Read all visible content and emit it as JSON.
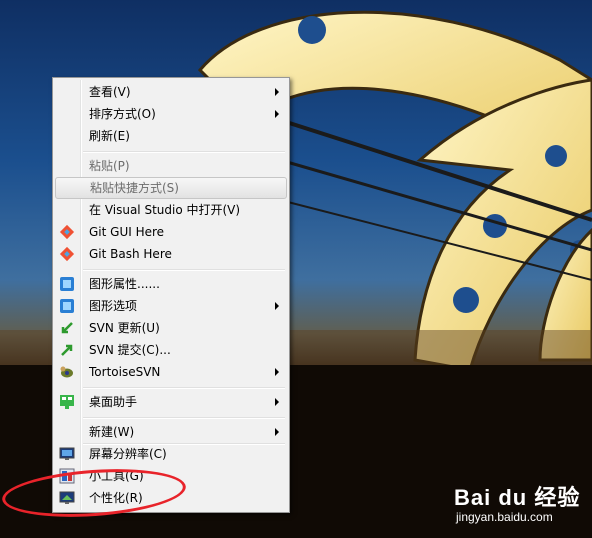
{
  "menu": {
    "items": [
      {
        "label": "查看(V)",
        "submenu": true
      },
      {
        "label": "排序方式(O)",
        "submenu": true
      },
      {
        "label": "刷新(E)"
      },
      {
        "label": "粘贴(P)",
        "disabled": true
      },
      {
        "label": "粘贴快捷方式(S)",
        "disabled": true,
        "hover": true
      },
      {
        "label": "在 Visual Studio 中打开(V)"
      },
      {
        "label": "Git GUI Here",
        "icon": "git-icon"
      },
      {
        "label": "Git Bash Here",
        "icon": "git-icon"
      },
      {
        "label": "图形属性......",
        "icon": "intel-graphics-icon"
      },
      {
        "label": "图形选项",
        "icon": "intel-graphics-icon",
        "submenu": true
      },
      {
        "label": "SVN 更新(U)",
        "icon": "svn-update-icon"
      },
      {
        "label": "SVN 提交(C)...",
        "icon": "svn-commit-icon"
      },
      {
        "label": "TortoiseSVN",
        "icon": "tortoise-svn-icon",
        "submenu": true
      },
      {
        "label": "桌面助手",
        "icon": "desktop-assistant-icon",
        "submenu": true
      },
      {
        "label": "新建(W)",
        "submenu": true
      },
      {
        "label": "屏幕分辨率(C)",
        "icon": "screen-resolution-icon"
      },
      {
        "label": "小工具(G)",
        "icon": "gadgets-icon"
      },
      {
        "label": "个性化(R)",
        "icon": "personalize-icon"
      }
    ]
  },
  "watermark": {
    "brand": "Bai du 经验",
    "url": "jingyan.baidu.com"
  },
  "colors": {
    "annotation": "#e8232a",
    "menu_bg": "#f1f1f1"
  }
}
